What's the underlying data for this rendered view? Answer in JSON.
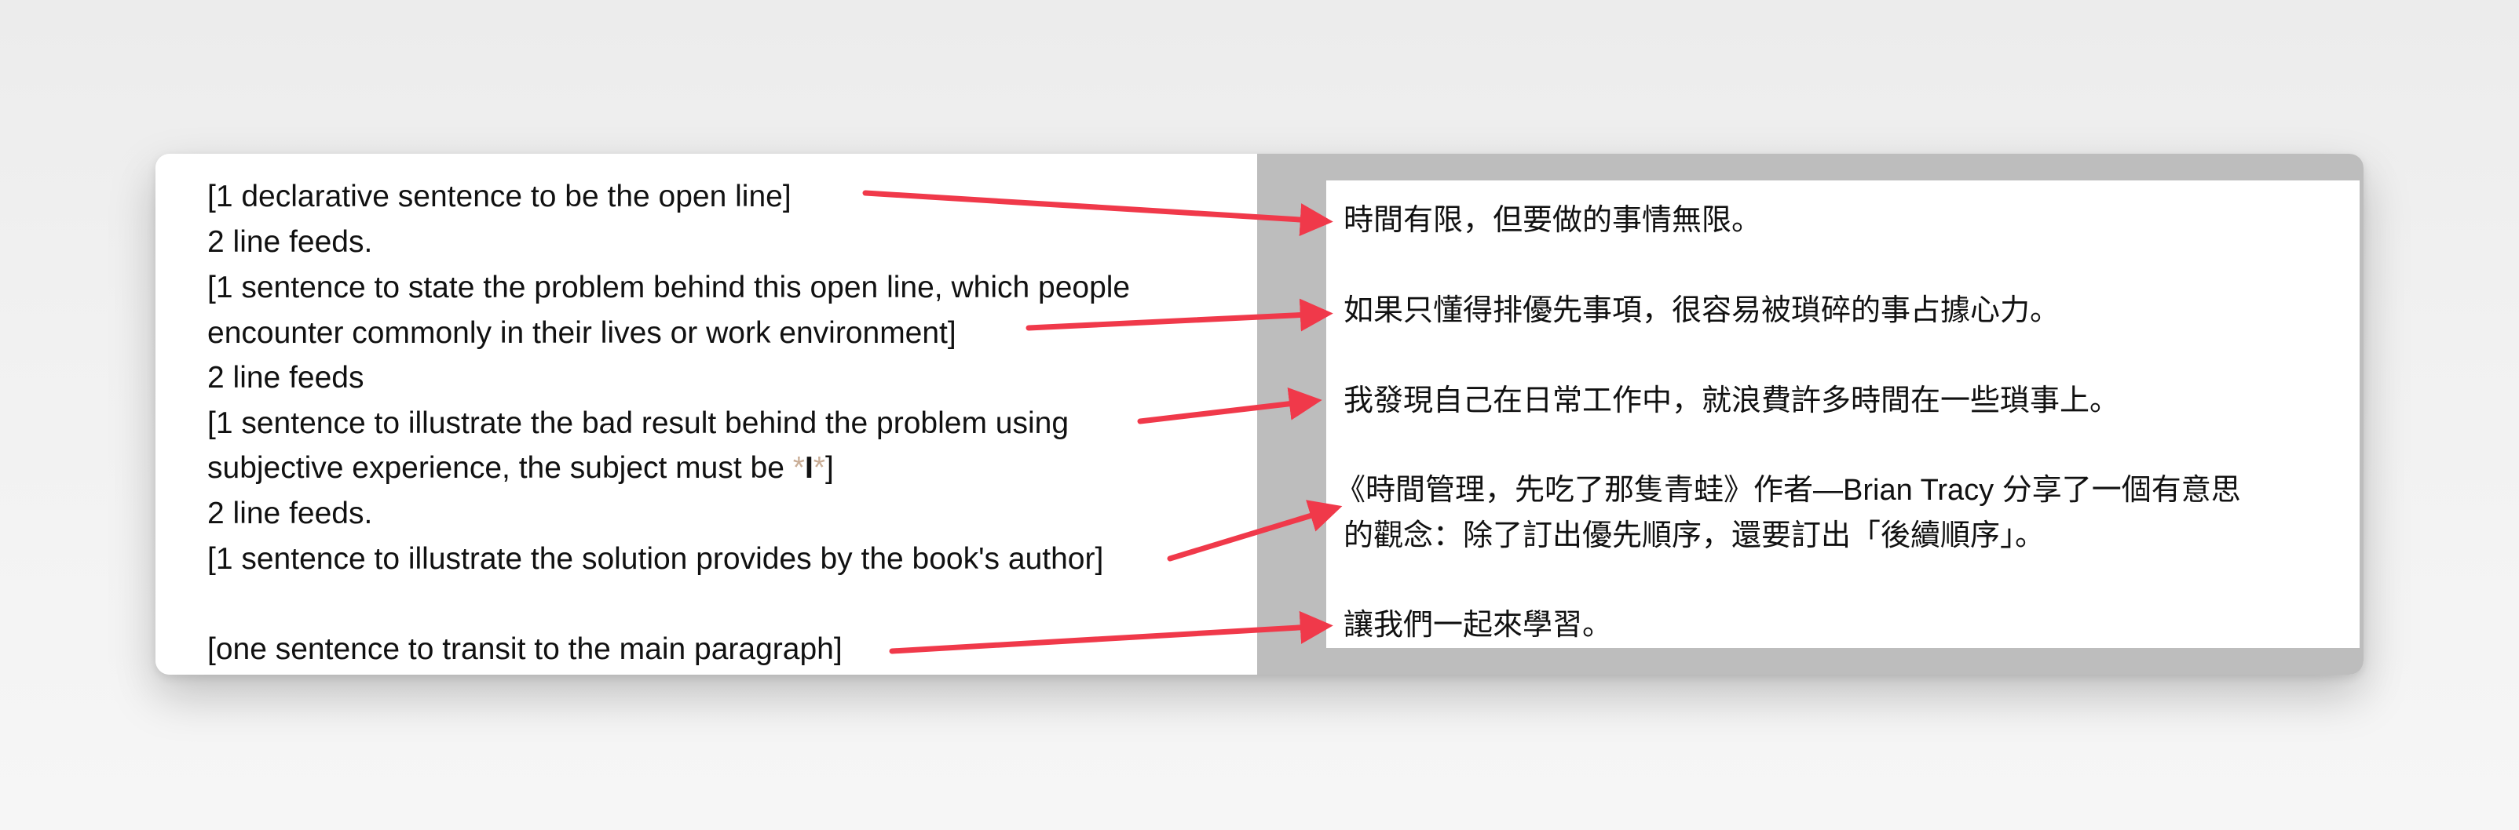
{
  "template": {
    "line1": "[1 declarative sentence to be the open line]",
    "line2": "2 line feeds.",
    "line3": "[1 sentence to state the problem behind this open line, which people",
    "line4": "encounter commonly in their lives or work environment]",
    "line5": "2 line feeds",
    "line6": "[1 sentence to illustrate the bad result behind the problem using",
    "line7_before": "subjective experience, the subject must be ",
    "line7_em1": "*",
    "line7_bold": "I",
    "line7_em2": "*",
    "line7_after": "]",
    "line8": "2 line feeds.",
    "line9": "[1 sentence to illustrate the solution provides by the book's author]",
    "line10": "[one sentence to transit to the main paragraph]"
  },
  "output": {
    "line1": "時間有限，但要做的事情無限。",
    "line2": "如果只懂得排優先事項，很容易被瑣碎的事占據心力。",
    "line3": "我發現自己在日常工作中，就浪費許多時間在一些瑣事上。",
    "line4": "《時間管理，先吃了那隻青蛙》作者—Brian Tracy 分享了一個有意思",
    "line5": "的觀念：除了訂出優先順序，還要訂出「後續順序」。",
    "line6": "讓我們一起來學習。"
  },
  "colors": {
    "arrow": "#f0394a",
    "pane_gray": "#bdbdbd"
  }
}
